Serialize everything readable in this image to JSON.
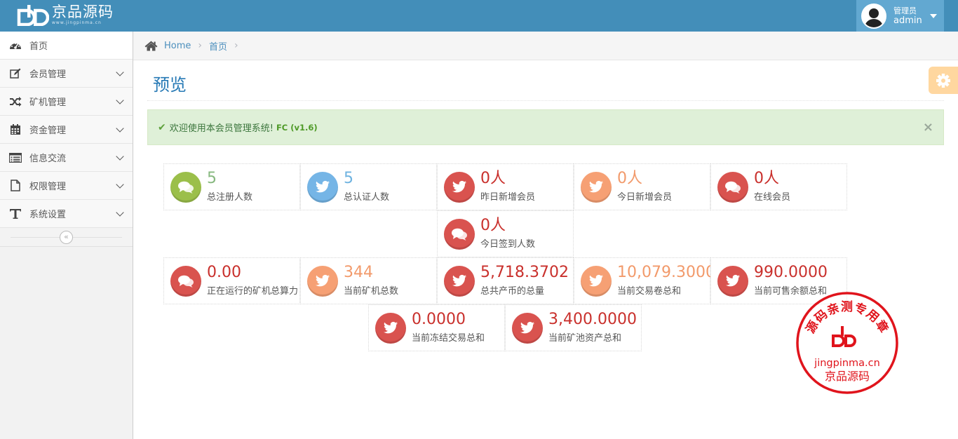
{
  "header": {
    "logo_text": "京品源码",
    "logo_url": "www.jingpinma.cn",
    "user_role": "管理员",
    "user_name": "admin"
  },
  "sidebar": {
    "items": [
      {
        "label": "首页",
        "icon": "dashboard-icon"
      },
      {
        "label": "会员管理",
        "icon": "edit-icon"
      },
      {
        "label": "矿机管理",
        "icon": "shuffle-icon"
      },
      {
        "label": "资金管理",
        "icon": "calendar-icon"
      },
      {
        "label": "信息交流",
        "icon": "list-icon"
      },
      {
        "label": "权限管理",
        "icon": "file-icon"
      },
      {
        "label": "系统设置",
        "icon": "text-icon"
      }
    ],
    "collapse_glyph": "«"
  },
  "breadcrumb": {
    "home": "Home",
    "current": "首页"
  },
  "page": {
    "title": "预览"
  },
  "alert": {
    "message": "欢迎使用本会员管理系统!",
    "version": "FC (v1.6)"
  },
  "stats": [
    {
      "value": "5",
      "label": "总注册人数",
      "color": "#87b87f",
      "icon": "comments-icon"
    },
    {
      "value": "5",
      "label": "总认证人数",
      "color": "#6fb3e0",
      "icon": "twitter-icon"
    },
    {
      "value": "0人",
      "label": "昨日新增会员",
      "color": "#d15b47",
      "icon": "twitter-icon"
    },
    {
      "value": "0人",
      "label": "今日新增会员",
      "color": "#fe9e19",
      "icon": "twitter-icon"
    },
    {
      "value": "0人",
      "label": "在线会员",
      "color": "#d15b47",
      "icon": "comments-icon"
    },
    {
      "value": "0人",
      "label": "今日签到人数",
      "color": "#d15b47",
      "icon": "comments-icon"
    },
    {
      "value": "0.00",
      "label": "正在运行的矿机总算力",
      "color": "#d15b47",
      "icon": "comments-icon"
    },
    {
      "value": "344",
      "label": "当前矿机总数",
      "color": "#fe9e19",
      "icon": "twitter-icon"
    },
    {
      "value": "5,718.3702",
      "label": "总共产币的总量",
      "color": "#d15b47",
      "icon": "twitter-icon"
    },
    {
      "value": "10,079.3000",
      "label": "当前交易卷总和",
      "color": "#fe9e19",
      "icon": "twitter-icon"
    },
    {
      "value": "990.0000",
      "label": "当前可售余额总和",
      "color": "#d15b47",
      "icon": "twitter-icon"
    },
    {
      "value": "0.0000",
      "label": "当前冻结交易总和",
      "color": "#d15b47",
      "icon": "twitter-icon"
    },
    {
      "value": "3,400.0000",
      "label": "当前矿池资产总和",
      "color": "#d15b47",
      "icon": "twitter-icon"
    }
  ],
  "stamp": {
    "top_text": "源码亲测专用章",
    "url": "jingpinma.cn",
    "name": "京品源码"
  },
  "colors": {
    "navbar": "#438eb9",
    "accent": "#2679b5",
    "stamp_red": "#e0141c"
  }
}
